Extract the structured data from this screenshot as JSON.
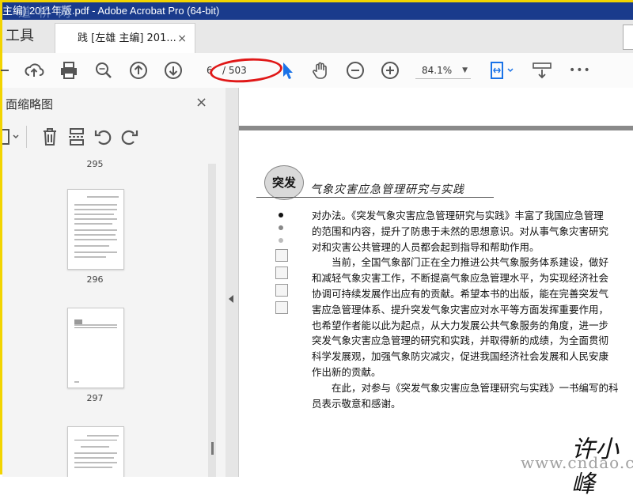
{
  "window": {
    "title": "主编) 2011年版.pdf - Adobe Acrobat Pro (64-bit)",
    "watermark_top": "道  桥  网"
  },
  "tabs": {
    "tools_label": "工具",
    "doc_label": "践 [左雄 主编] 201...",
    "close_glyph": "×"
  },
  "toolbar": {
    "page_current": "6",
    "page_total": "/ 503",
    "zoom": "84.1%",
    "dropdown_glyph": "▼",
    "more_glyph": "•••",
    "icons": [
      "upload-icon",
      "print-icon",
      "zoom-search-icon",
      "page-up-icon",
      "page-down-icon",
      "select-pointer-icon",
      "hand-icon",
      "zoom-out-icon",
      "zoom-in-icon",
      "fit-page-icon",
      "scroll-mode-icon",
      "more-icon"
    ]
  },
  "left_panel": {
    "title": "面缩略图",
    "close_glyph": "×",
    "thumbnails": [
      {
        "label": "295"
      },
      {
        "label": "296"
      },
      {
        "label": "297"
      },
      {
        "label": ""
      }
    ]
  },
  "document": {
    "badge": "突发",
    "header_title": "气象灾害应急管理研究与实践",
    "paragraphs": [
      "对办法。《突发气象灾害应急管理研究与实践》丰富了我国应急管理",
      "的范围和内容，提升了防患于未然的思想意识。对从事气象灾害研究",
      "对和灾害公共管理的人员都会起到指导和帮助作用。",
      "　　当前，全国气象部门正在全力推进公共气象服务体系建设，做好",
      "和减轻气象灾害工作，不断提高气象应急管理水平，为实现经济社会",
      "协调可持续发展作出应有的贡献。希望本书的出版，能在完善突发气",
      "害应急管理体系、提升突发气象灾害应对水平等方面发挥重要作用，",
      "也希望作者能以此为起点，从大力发展公共气象服务的角度，进一步",
      "突发气象灾害应急管理的研究和实践，并取得新的成绩，为全面贯彻",
      "科学发展观，加强气象防灾减灾，促进我国经济社会发展和人民安康",
      "作出新的贡献。",
      "　　在此，对参与《突发气象灾害应急管理研究与实践》一书编写的科",
      "员表示敬意和感谢。"
    ],
    "signature": "许小峰",
    "watermark": "www.cndao.com"
  },
  "colors": {
    "titlebar": "#1a3b8c",
    "frame": "#f2d400",
    "annotation": "#e01818",
    "pointer_blue": "#1a73e8"
  }
}
